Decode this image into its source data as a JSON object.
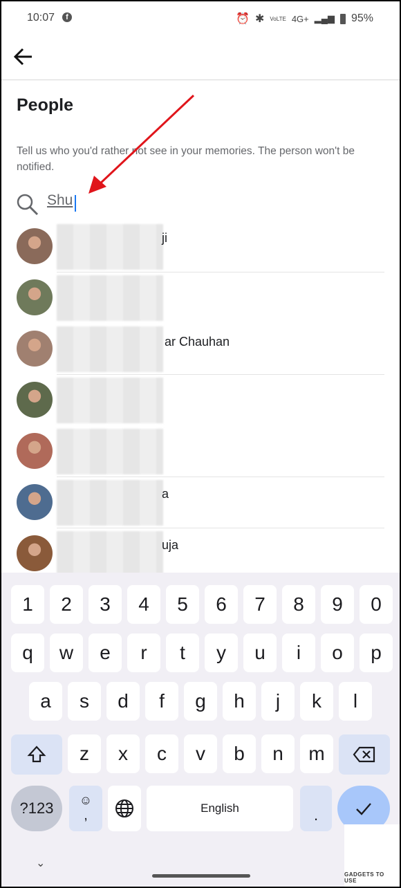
{
  "status": {
    "time": "10:07",
    "network": "4G+",
    "battery": "95%",
    "volte": "VoLTE"
  },
  "header": {
    "back_icon": "arrow-left-icon"
  },
  "page": {
    "title": "People",
    "description": "Tell us who you'd rather not see in your memories. The person won't be notified."
  },
  "search": {
    "value": "Shu",
    "icon": "search-icon"
  },
  "people": [
    {
      "visible_name": "ji",
      "divider": true
    },
    {
      "visible_name": "",
      "divider": false
    },
    {
      "visible_name": "ar Chauhan",
      "divider": true
    },
    {
      "visible_name": "",
      "divider": false
    },
    {
      "visible_name": "",
      "divider": true
    },
    {
      "visible_name": "a",
      "divider": true
    },
    {
      "visible_name": "uja",
      "divider": false
    }
  ],
  "keyboard": {
    "rows": [
      [
        "1",
        "2",
        "3",
        "4",
        "5",
        "6",
        "7",
        "8",
        "9",
        "0"
      ],
      [
        "q",
        "w",
        "e",
        "r",
        "t",
        "y",
        "u",
        "i",
        "o",
        "p"
      ],
      [
        "a",
        "s",
        "d",
        "f",
        "g",
        "h",
        "j",
        "k",
        "l"
      ],
      [
        "z",
        "x",
        "c",
        "v",
        "b",
        "n",
        "m"
      ]
    ],
    "symbols_label": "?123",
    "space_label": "English",
    "comma": ",",
    "period": ".",
    "colors": {
      "background": "#f1eff5",
      "modifier": "#dbe3f5",
      "enter": "#a8c7fa"
    }
  },
  "watermark": "GADGETS TO USE",
  "accent": "#e0151b"
}
